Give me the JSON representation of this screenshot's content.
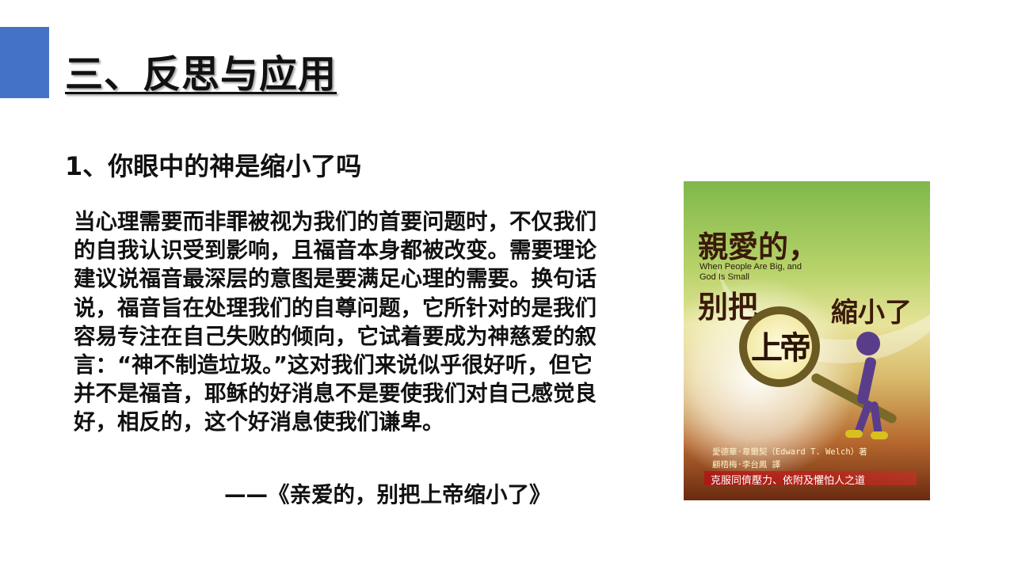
{
  "title": "三、反思与应用",
  "subtitle": "1、你眼中的神是缩小了吗",
  "quote": "当心理需要而非罪被视为我们的首要问题时，不仅我们的自我认识受到影响，且福音本身都被改变。需要理论建议说福音最深层的意图是要满足心理的需要。换句话说，福音旨在处理我们的自尊问题，它所针对的是我们容易专注在自己失败的倾向，它试着要成为神慈爱的叙言：“神不制造垃圾。”这对我们来说似乎很好听，但它并不是福音，耶稣的好消息不是要使我们对自己感觉良好，相反的，这个好消息使我们谦卑。",
  "source": "——《亲爱的，别把上帝缩小了》",
  "book_cover": {
    "title_line1": "親愛的，",
    "english_title": "When People Are Big, and God Is Small",
    "title_line2": "别把",
    "title_line3": "縮小了",
    "magnified_word": "上帝",
    "author": "愛德華·韋爾契（Edward T. Welch）著",
    "translator": "顧梧梅·李台鳳  譯",
    "tagline": "克服同儕壓力、依附及懼怕人之道"
  },
  "colors": {
    "accent": "#4472c4"
  }
}
